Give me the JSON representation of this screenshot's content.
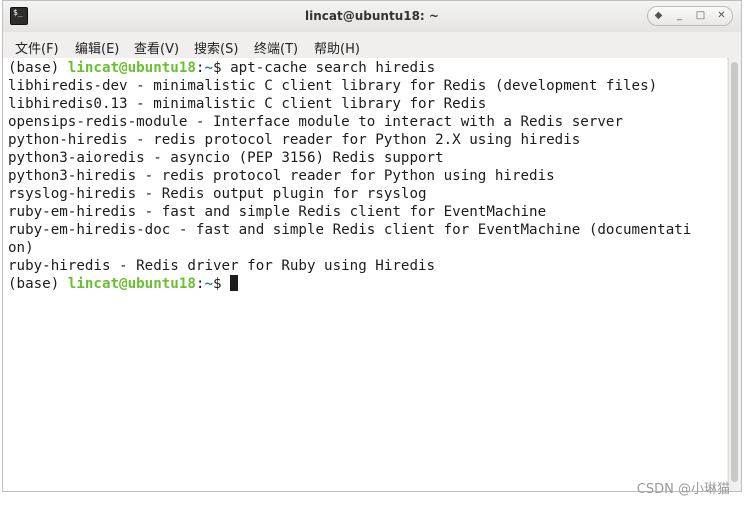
{
  "window": {
    "title": "lincat@ubuntu18: ~",
    "icon": "terminal-icon",
    "controls": [
      "◆",
      "_",
      "□",
      "✕"
    ]
  },
  "menu": [
    {
      "label": "文件(F)"
    },
    {
      "label": "编辑(E)"
    },
    {
      "label": "查看(V)"
    },
    {
      "label": "搜索(S)"
    },
    {
      "label": "终端(T)"
    },
    {
      "label": "帮助(H)"
    }
  ],
  "terminal": {
    "prompt": {
      "env": "(base) ",
      "user": "lincat@ubuntu18",
      "sep": ":",
      "path": "~",
      "symbol": "$ "
    },
    "command": "apt-cache search hiredis",
    "output": [
      "libhiredis-dev - minimalistic C client library for Redis (development files)",
      "libhiredis0.13 - minimalistic C client library for Redis",
      "opensips-redis-module - Interface module to interact with a Redis server",
      "python-hiredis - redis protocol reader for Python 2.X using hiredis",
      "python3-aioredis - asyncio (PEP 3156) Redis support",
      "python3-hiredis - redis protocol reader for Python using hiredis",
      "rsyslog-hiredis - Redis output plugin for rsyslog",
      "ruby-em-hiredis - fast and simple Redis client for EventMachine",
      "ruby-em-hiredis-doc - fast and simple Redis client for EventMachine (documentati",
      "on)",
      "ruby-hiredis - Redis driver for Ruby using Hiredis"
    ]
  },
  "watermark": "CSDN @小琳猫"
}
